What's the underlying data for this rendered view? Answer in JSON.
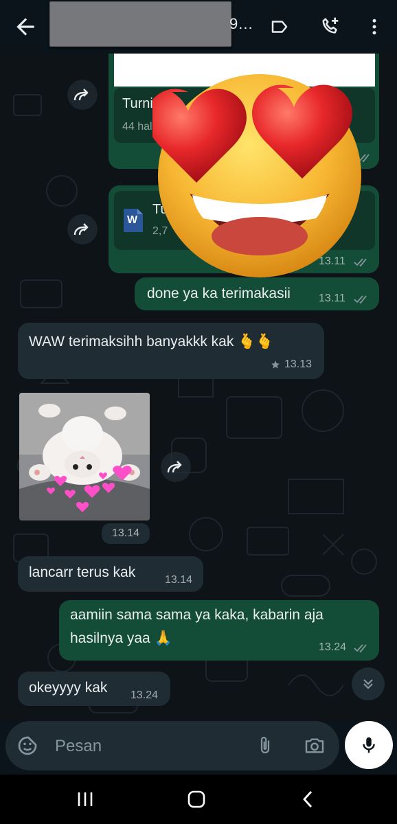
{
  "header": {
    "contact_suffix": "9...",
    "icons": [
      "arrow-left-icon",
      "label-icon",
      "add-call-icon",
      "more-vert-icon"
    ]
  },
  "messages": {
    "doc1": {
      "title": "Turnit",
      "subtitle": "44 hal",
      "direction": "outgoing"
    },
    "doc2": {
      "title": "Tu",
      "subtitle": "2,7",
      "time": "13.11",
      "file_icon_letter": "W",
      "direction": "outgoing"
    },
    "done": {
      "text": "done ya ka terimakasii",
      "time": "13.11",
      "direction": "outgoing"
    },
    "waw": {
      "text": "WAW terimaksihh banyakkk kak 🫰🫰",
      "time": "13.13",
      "starred": true,
      "direction": "incoming"
    },
    "photo": {
      "time": "13.14",
      "description_icon": "cat-photo",
      "direction": "incoming"
    },
    "lancar": {
      "text": "lancarr terus kak",
      "time": "13.14",
      "direction": "incoming"
    },
    "aamiin": {
      "line1": "aamiin sama sama ya kaka, kabarin aja",
      "line2": "hasilnya yaa 🙏",
      "time": "13.24",
      "direction": "outgoing"
    },
    "okey": {
      "text": "okeyyyy kak",
      "time": "13.24",
      "direction": "incoming"
    }
  },
  "composer": {
    "placeholder": "Pesan",
    "icons": [
      "sticker-icon",
      "attach-icon",
      "camera-icon",
      "mic-icon"
    ]
  },
  "navbar": {
    "icons": [
      "recents-icon",
      "home-icon",
      "back-icon"
    ]
  },
  "colors": {
    "outgoing_bubble": "#144d37",
    "incoming_bubble": "#1f2c34",
    "background": "#0b141a",
    "read_ticks": "#8696a0"
  }
}
